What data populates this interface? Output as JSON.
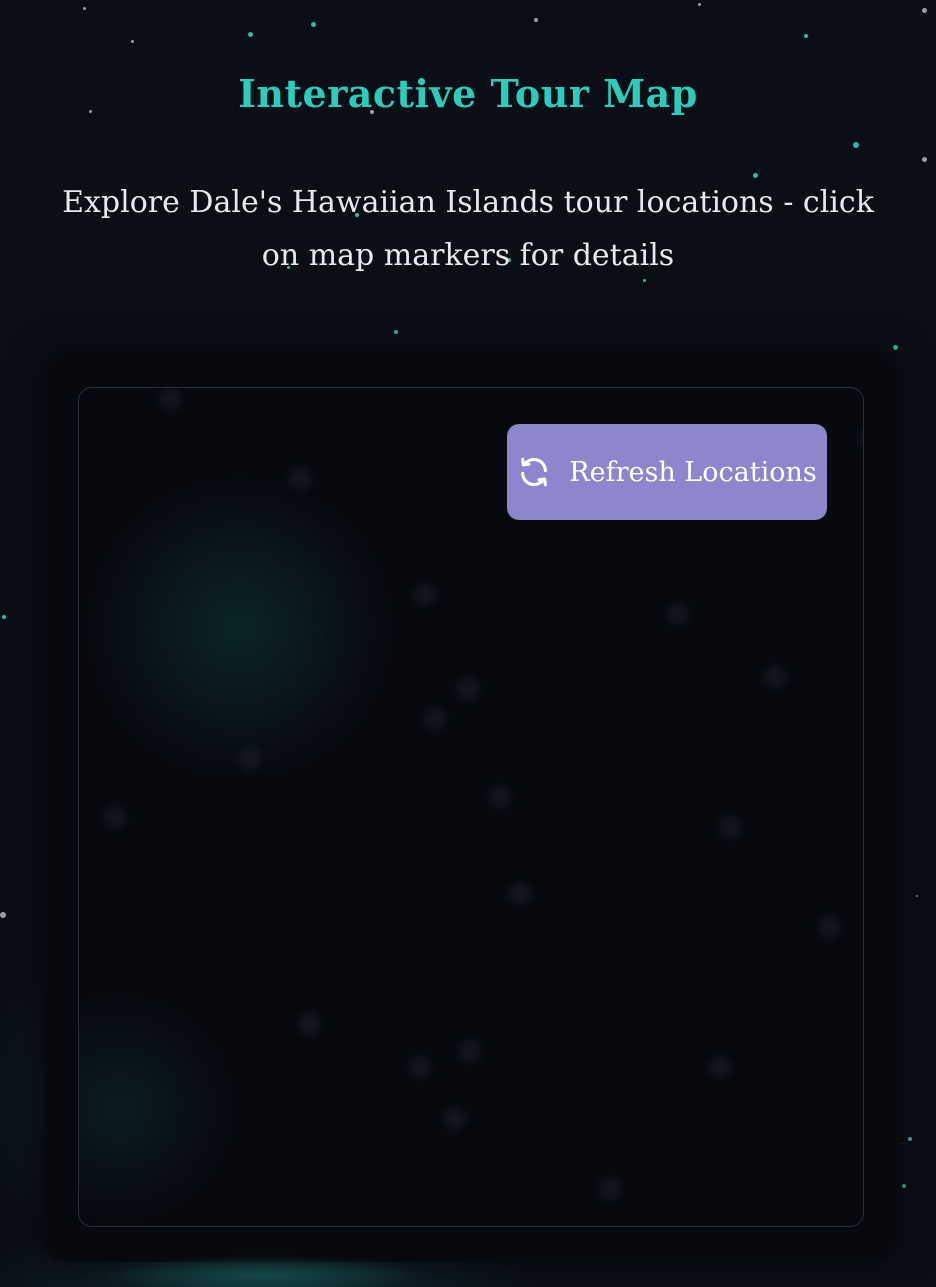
{
  "header": {
    "title": "Interactive Tour Map",
    "subtitle": "Explore Dale's Hawaiian Islands tour locations - click on map markers for details"
  },
  "map": {
    "refresh_button": {
      "label": "Refresh Locations",
      "icon": "refresh-icon"
    }
  },
  "colors": {
    "accent": "#2ccdb8",
    "button": "#8e86cc",
    "background": "#0a0e16"
  }
}
